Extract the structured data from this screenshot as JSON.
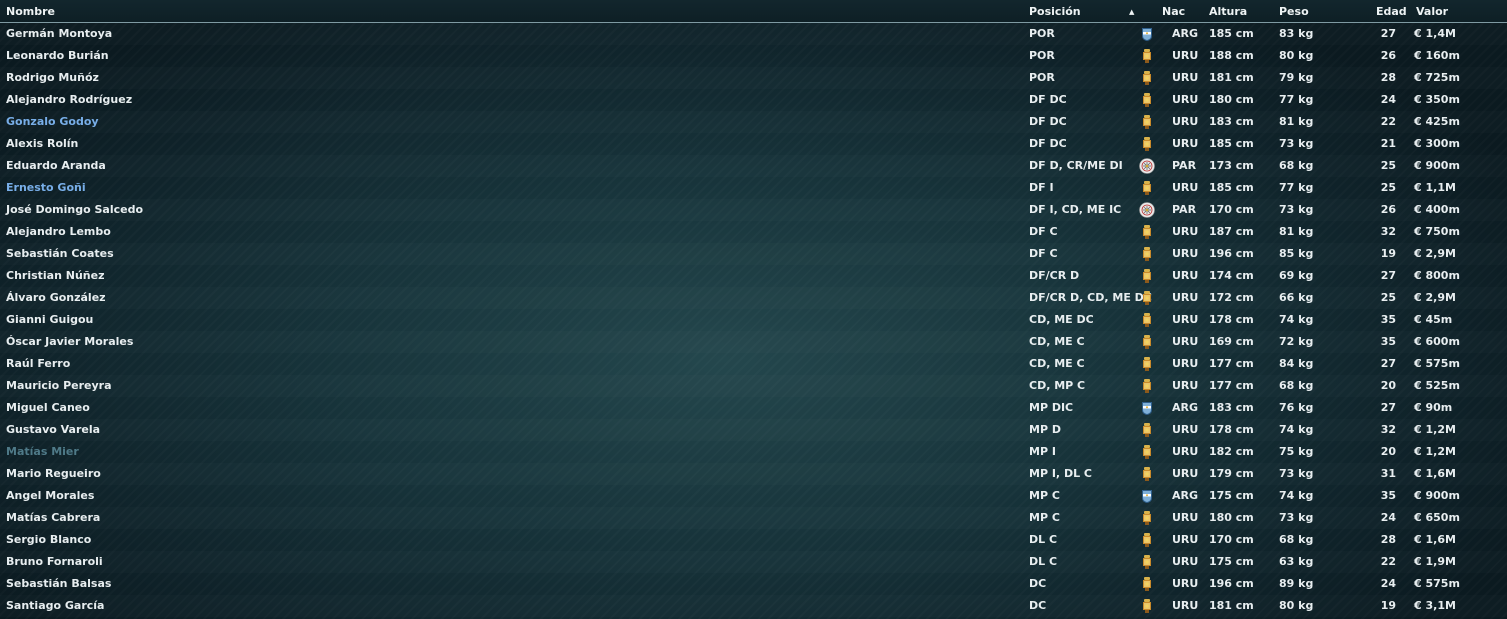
{
  "columns": {
    "name": "Nombre",
    "position": "Posición",
    "sort_indicator": "▲",
    "nation": "Nac",
    "height": "Altura",
    "weight": "Peso",
    "age": "Edad",
    "value": "Valor"
  },
  "players": [
    {
      "name": "Germán Montoya",
      "position": "POR",
      "flag": "arg-flag-icon",
      "nation": "ARG",
      "height": "185 cm",
      "weight": "83 kg",
      "age": "27",
      "value": "€ 1,4M",
      "style": ""
    },
    {
      "name": "Leonardo Burián",
      "position": "POR",
      "flag": "uru-flag-icon",
      "nation": "URU",
      "height": "188 cm",
      "weight": "80 kg",
      "age": "26",
      "value": "€ 160m",
      "style": ""
    },
    {
      "name": "Rodrigo Muñóz",
      "position": "POR",
      "flag": "uru-flag-icon",
      "nation": "URU",
      "height": "181 cm",
      "weight": "79 kg",
      "age": "28",
      "value": "€ 725m",
      "style": ""
    },
    {
      "name": "Alejandro Rodríguez",
      "position": "DF DC",
      "flag": "uru-flag-icon",
      "nation": "URU",
      "height": "180 cm",
      "weight": "77 kg",
      "age": "24",
      "value": "€ 350m",
      "style": ""
    },
    {
      "name": "Gonzalo Godoy",
      "position": "DF DC",
      "flag": "uru-flag-icon",
      "nation": "URU",
      "height": "183 cm",
      "weight": "81 kg",
      "age": "22",
      "value": "€ 425m",
      "style": "highlight"
    },
    {
      "name": "Alexis Rolín",
      "position": "DF DC",
      "flag": "uru-flag-icon",
      "nation": "URU",
      "height": "185 cm",
      "weight": "73 kg",
      "age": "21",
      "value": "€ 300m",
      "style": ""
    },
    {
      "name": "Eduardo Aranda",
      "position": "DF D, CR/ME DI",
      "flag": "par-flag-icon",
      "nation": "PAR",
      "height": "173 cm",
      "weight": "68 kg",
      "age": "25",
      "value": "€ 900m",
      "style": ""
    },
    {
      "name": "Ernesto Goñi",
      "position": "DF I",
      "flag": "uru-flag-icon",
      "nation": "URU",
      "height": "185 cm",
      "weight": "77 kg",
      "age": "25",
      "value": "€ 1,1M",
      "style": "highlight"
    },
    {
      "name": "José Domingo Salcedo",
      "position": "DF I, CD, ME IC",
      "flag": "par-flag-icon",
      "nation": "PAR",
      "height": "170 cm",
      "weight": "73 kg",
      "age": "26",
      "value": "€ 400m",
      "style": ""
    },
    {
      "name": "Alejandro Lembo",
      "position": "DF C",
      "flag": "uru-flag-icon",
      "nation": "URU",
      "height": "187 cm",
      "weight": "81 kg",
      "age": "32",
      "value": "€ 750m",
      "style": ""
    },
    {
      "name": "Sebastián Coates",
      "position": "DF C",
      "flag": "uru-flag-icon",
      "nation": "URU",
      "height": "196 cm",
      "weight": "85 kg",
      "age": "19",
      "value": "€ 2,9M",
      "style": ""
    },
    {
      "name": "Christian Núñez",
      "position": "DF/CR D",
      "flag": "uru-flag-icon",
      "nation": "URU",
      "height": "174 cm",
      "weight": "69 kg",
      "age": "27",
      "value": "€ 800m",
      "style": ""
    },
    {
      "name": "Álvaro González",
      "position": "DF/CR D, CD, ME DC",
      "flag": "uru-flag-icon",
      "nation": "URU",
      "height": "172 cm",
      "weight": "66 kg",
      "age": "25",
      "value": "€ 2,9M",
      "style": ""
    },
    {
      "name": "Gianni Guigou",
      "position": "CD, ME DC",
      "flag": "uru-flag-icon",
      "nation": "URU",
      "height": "178 cm",
      "weight": "74 kg",
      "age": "35",
      "value": "€ 45m",
      "style": ""
    },
    {
      "name": "Óscar Javier Morales",
      "position": "CD, ME C",
      "flag": "uru-flag-icon",
      "nation": "URU",
      "height": "169 cm",
      "weight": "72 kg",
      "age": "35",
      "value": "€ 600m",
      "style": ""
    },
    {
      "name": "Raúl Ferro",
      "position": "CD, ME C",
      "flag": "uru-flag-icon",
      "nation": "URU",
      "height": "177 cm",
      "weight": "84 kg",
      "age": "27",
      "value": "€ 575m",
      "style": ""
    },
    {
      "name": "Mauricio Pereyra",
      "position": "CD, MP C",
      "flag": "uru-flag-icon",
      "nation": "URU",
      "height": "177 cm",
      "weight": "68 kg",
      "age": "20",
      "value": "€ 525m",
      "style": ""
    },
    {
      "name": "Miguel Caneo",
      "position": "MP DIC",
      "flag": "arg-flag-icon",
      "nation": "ARG",
      "height": "183 cm",
      "weight": "76 kg",
      "age": "27",
      "value": "€ 90m",
      "style": ""
    },
    {
      "name": "Gustavo Varela",
      "position": "MP D",
      "flag": "uru-flag-icon",
      "nation": "URU",
      "height": "178 cm",
      "weight": "74 kg",
      "age": "32",
      "value": "€ 1,2M",
      "style": ""
    },
    {
      "name": "Matías Mier",
      "position": "MP I",
      "flag": "uru-flag-icon",
      "nation": "URU",
      "height": "182 cm",
      "weight": "75 kg",
      "age": "20",
      "value": "€ 1,2M",
      "style": "dim"
    },
    {
      "name": "Mario Regueiro",
      "position": "MP I, DL C",
      "flag": "uru-flag-icon",
      "nation": "URU",
      "height": "179 cm",
      "weight": "73 kg",
      "age": "31",
      "value": "€ 1,6M",
      "style": ""
    },
    {
      "name": "Angel Morales",
      "position": "MP C",
      "flag": "arg-flag-icon",
      "nation": "ARG",
      "height": "175 cm",
      "weight": "74 kg",
      "age": "35",
      "value": "€ 900m",
      "style": ""
    },
    {
      "name": "Matías Cabrera",
      "position": "MP C",
      "flag": "uru-flag-icon",
      "nation": "URU",
      "height": "180 cm",
      "weight": "73 kg",
      "age": "24",
      "value": "€ 650m",
      "style": ""
    },
    {
      "name": "Sergio Blanco",
      "position": "DL C",
      "flag": "uru-flag-icon",
      "nation": "URU",
      "height": "170 cm",
      "weight": "68 kg",
      "age": "28",
      "value": "€ 1,6M",
      "style": ""
    },
    {
      "name": "Bruno Fornaroli",
      "position": "DL C",
      "flag": "uru-flag-icon",
      "nation": "URU",
      "height": "175 cm",
      "weight": "63 kg",
      "age": "22",
      "value": "€ 1,9M",
      "style": ""
    },
    {
      "name": "Sebastián Balsas",
      "position": "DC",
      "flag": "uru-flag-icon",
      "nation": "URU",
      "height": "196 cm",
      "weight": "89 kg",
      "age": "24",
      "value": "€ 575m",
      "style": ""
    },
    {
      "name": "Santiago García",
      "position": "DC",
      "flag": "uru-flag-icon",
      "nation": "URU",
      "height": "181 cm",
      "weight": "80 kg",
      "age": "19",
      "value": "€ 3,1M",
      "style": ""
    }
  ],
  "colors": {
    "highlight_name": "#78aee8",
    "dim_name": "#4f7a88"
  }
}
